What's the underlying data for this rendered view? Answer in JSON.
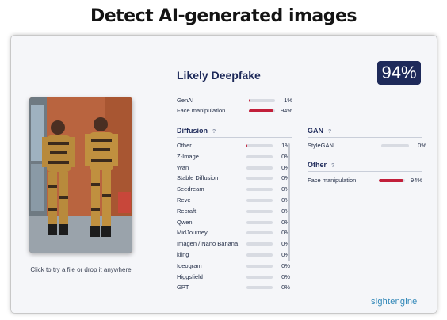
{
  "headline": "Detect AI-generated images",
  "upload_hint": "Click to try a file or drop it anywhere",
  "result": {
    "verdict": "Likely Deepfake",
    "score": "94%"
  },
  "summary": [
    {
      "label": "GenAI",
      "pct": "1%",
      "value": 0.01
    },
    {
      "label": "Face manipulation",
      "pct": "94%",
      "value": 0.94
    }
  ],
  "diffusion": {
    "title": "Diffusion",
    "help": "?",
    "items": [
      {
        "label": "Other",
        "pct": "1%",
        "value": 0.01
      },
      {
        "label": "Z-Image",
        "pct": "0%",
        "value": 0
      },
      {
        "label": "Wan",
        "pct": "0%",
        "value": 0
      },
      {
        "label": "Stable Diffusion",
        "pct": "0%",
        "value": 0
      },
      {
        "label": "Seedream",
        "pct": "0%",
        "value": 0
      },
      {
        "label": "Reve",
        "pct": "0%",
        "value": 0
      },
      {
        "label": "Recraft",
        "pct": "0%",
        "value": 0
      },
      {
        "label": "Qwen",
        "pct": "0%",
        "value": 0
      },
      {
        "label": "MidJourney",
        "pct": "0%",
        "value": 0
      },
      {
        "label": "Imagen / Nano Banana",
        "pct": "0%",
        "value": 0
      },
      {
        "label": "kling",
        "pct": "0%",
        "value": 0
      },
      {
        "label": "Ideogram",
        "pct": "0%",
        "value": 0
      },
      {
        "label": "Higgsfield",
        "pct": "0%",
        "value": 0
      },
      {
        "label": "GPT",
        "pct": "0%",
        "value": 0
      }
    ]
  },
  "gan": {
    "title": "GAN",
    "help": "?",
    "items": [
      {
        "label": "StyleGAN",
        "pct": "0%",
        "value": 0
      }
    ]
  },
  "other": {
    "title": "Other",
    "help": "?",
    "items": [
      {
        "label": "Face manipulation",
        "pct": "94%",
        "value": 0.94
      }
    ]
  },
  "brand": {
    "part1": "sight",
    "part2": "engine"
  },
  "colors": {
    "accent": "#1e2a5a",
    "danger": "#c21f3a",
    "track": "#d8dbe2",
    "brand": "#2f86b7"
  }
}
